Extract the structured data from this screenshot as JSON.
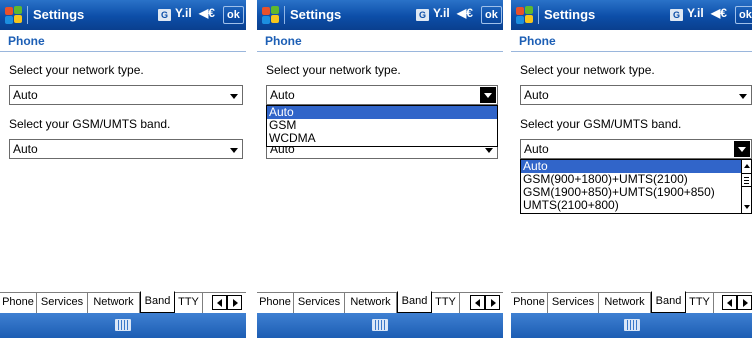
{
  "status_bar": {
    "title": "Settings",
    "ok_label": "ok",
    "data_indicator": "G",
    "signal_icon": "antenna-signal-icon",
    "volume_icon": "speaker-icon",
    "signal_glyph": "Y.il",
    "volume_glyph": "◀€"
  },
  "page": {
    "heading": "Phone",
    "network_label": "Select your network type.",
    "band_label": "Select your GSM/UMTS band."
  },
  "screens": [
    {
      "network_value": "Auto",
      "band_value": "Auto",
      "open_dropdown": "none"
    },
    {
      "network_value": "Auto",
      "band_value": "Auto",
      "open_dropdown": "network"
    },
    {
      "network_value": "Auto",
      "band_value": "Auto",
      "open_dropdown": "band"
    }
  ],
  "network_options": [
    "Auto",
    "GSM",
    "WCDMA"
  ],
  "network_selected_index": 0,
  "band_options": [
    "Auto",
    "GSM(900+1800)+UMTS(2100)",
    "GSM(1900+850)+UMTS(1900+850)",
    "UMTS(2100+800)"
  ],
  "band_selected_index": 0,
  "tabs": [
    {
      "label": "Phone",
      "active": false
    },
    {
      "label": "Services",
      "active": false
    },
    {
      "label": "Network",
      "active": false
    },
    {
      "label": "Band",
      "active": true
    },
    {
      "label": "TTY",
      "active": false
    }
  ],
  "tab_scroll": {
    "left_icon": "scroll-left-arrow-icon",
    "right_icon": "scroll-right-arrow-icon"
  },
  "menu_bar": {
    "keyboard_icon": "keyboard-icon"
  },
  "colors": {
    "title_bar": "#0c4ea8",
    "heading_text": "#1d5fb5",
    "selection": "#3165c9"
  }
}
